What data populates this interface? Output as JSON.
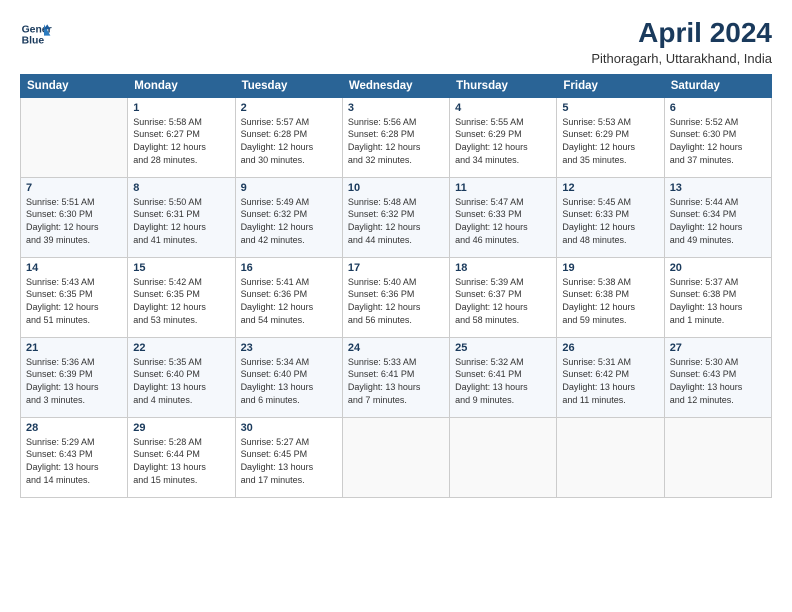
{
  "header": {
    "logo_line1": "General",
    "logo_line2": "Blue",
    "main_title": "April 2024",
    "subtitle": "Pithoragarh, Uttarakhand, India"
  },
  "weekdays": [
    "Sunday",
    "Monday",
    "Tuesday",
    "Wednesday",
    "Thursday",
    "Friday",
    "Saturday"
  ],
  "weeks": [
    [
      {
        "day": "",
        "info": ""
      },
      {
        "day": "1",
        "info": "Sunrise: 5:58 AM\nSunset: 6:27 PM\nDaylight: 12 hours\nand 28 minutes."
      },
      {
        "day": "2",
        "info": "Sunrise: 5:57 AM\nSunset: 6:28 PM\nDaylight: 12 hours\nand 30 minutes."
      },
      {
        "day": "3",
        "info": "Sunrise: 5:56 AM\nSunset: 6:28 PM\nDaylight: 12 hours\nand 32 minutes."
      },
      {
        "day": "4",
        "info": "Sunrise: 5:55 AM\nSunset: 6:29 PM\nDaylight: 12 hours\nand 34 minutes."
      },
      {
        "day": "5",
        "info": "Sunrise: 5:53 AM\nSunset: 6:29 PM\nDaylight: 12 hours\nand 35 minutes."
      },
      {
        "day": "6",
        "info": "Sunrise: 5:52 AM\nSunset: 6:30 PM\nDaylight: 12 hours\nand 37 minutes."
      }
    ],
    [
      {
        "day": "7",
        "info": "Sunrise: 5:51 AM\nSunset: 6:30 PM\nDaylight: 12 hours\nand 39 minutes."
      },
      {
        "day": "8",
        "info": "Sunrise: 5:50 AM\nSunset: 6:31 PM\nDaylight: 12 hours\nand 41 minutes."
      },
      {
        "day": "9",
        "info": "Sunrise: 5:49 AM\nSunset: 6:32 PM\nDaylight: 12 hours\nand 42 minutes."
      },
      {
        "day": "10",
        "info": "Sunrise: 5:48 AM\nSunset: 6:32 PM\nDaylight: 12 hours\nand 44 minutes."
      },
      {
        "day": "11",
        "info": "Sunrise: 5:47 AM\nSunset: 6:33 PM\nDaylight: 12 hours\nand 46 minutes."
      },
      {
        "day": "12",
        "info": "Sunrise: 5:45 AM\nSunset: 6:33 PM\nDaylight: 12 hours\nand 48 minutes."
      },
      {
        "day": "13",
        "info": "Sunrise: 5:44 AM\nSunset: 6:34 PM\nDaylight: 12 hours\nand 49 minutes."
      }
    ],
    [
      {
        "day": "14",
        "info": "Sunrise: 5:43 AM\nSunset: 6:35 PM\nDaylight: 12 hours\nand 51 minutes."
      },
      {
        "day": "15",
        "info": "Sunrise: 5:42 AM\nSunset: 6:35 PM\nDaylight: 12 hours\nand 53 minutes."
      },
      {
        "day": "16",
        "info": "Sunrise: 5:41 AM\nSunset: 6:36 PM\nDaylight: 12 hours\nand 54 minutes."
      },
      {
        "day": "17",
        "info": "Sunrise: 5:40 AM\nSunset: 6:36 PM\nDaylight: 12 hours\nand 56 minutes."
      },
      {
        "day": "18",
        "info": "Sunrise: 5:39 AM\nSunset: 6:37 PM\nDaylight: 12 hours\nand 58 minutes."
      },
      {
        "day": "19",
        "info": "Sunrise: 5:38 AM\nSunset: 6:38 PM\nDaylight: 12 hours\nand 59 minutes."
      },
      {
        "day": "20",
        "info": "Sunrise: 5:37 AM\nSunset: 6:38 PM\nDaylight: 13 hours\nand 1 minute."
      }
    ],
    [
      {
        "day": "21",
        "info": "Sunrise: 5:36 AM\nSunset: 6:39 PM\nDaylight: 13 hours\nand 3 minutes."
      },
      {
        "day": "22",
        "info": "Sunrise: 5:35 AM\nSunset: 6:40 PM\nDaylight: 13 hours\nand 4 minutes."
      },
      {
        "day": "23",
        "info": "Sunrise: 5:34 AM\nSunset: 6:40 PM\nDaylight: 13 hours\nand 6 minutes."
      },
      {
        "day": "24",
        "info": "Sunrise: 5:33 AM\nSunset: 6:41 PM\nDaylight: 13 hours\nand 7 minutes."
      },
      {
        "day": "25",
        "info": "Sunrise: 5:32 AM\nSunset: 6:41 PM\nDaylight: 13 hours\nand 9 minutes."
      },
      {
        "day": "26",
        "info": "Sunrise: 5:31 AM\nSunset: 6:42 PM\nDaylight: 13 hours\nand 11 minutes."
      },
      {
        "day": "27",
        "info": "Sunrise: 5:30 AM\nSunset: 6:43 PM\nDaylight: 13 hours\nand 12 minutes."
      }
    ],
    [
      {
        "day": "28",
        "info": "Sunrise: 5:29 AM\nSunset: 6:43 PM\nDaylight: 13 hours\nand 14 minutes."
      },
      {
        "day": "29",
        "info": "Sunrise: 5:28 AM\nSunset: 6:44 PM\nDaylight: 13 hours\nand 15 minutes."
      },
      {
        "day": "30",
        "info": "Sunrise: 5:27 AM\nSunset: 6:45 PM\nDaylight: 13 hours\nand 17 minutes."
      },
      {
        "day": "",
        "info": ""
      },
      {
        "day": "",
        "info": ""
      },
      {
        "day": "",
        "info": ""
      },
      {
        "day": "",
        "info": ""
      }
    ]
  ]
}
